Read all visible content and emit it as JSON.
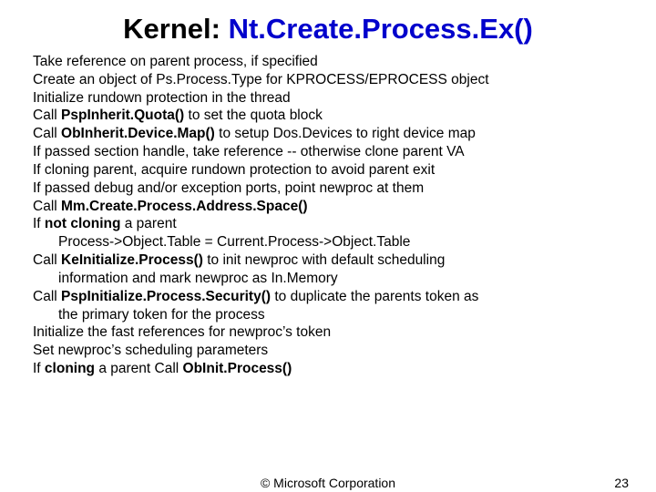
{
  "title": {
    "prefix": "Kernel:  ",
    "func": "Nt.Create.Process.Ex()"
  },
  "lines": {
    "l1": "Take reference on parent process, if specified",
    "l2": "Create an object of Ps.Process.Type for KPROCESS/EPROCESS object",
    "l3": "Initialize rundown protection in the thread",
    "l4a": "Call ",
    "l4b": "PspInherit.Quota()",
    "l4c": " to set the quota block",
    "l5a": "Call ",
    "l5b": "ObInherit.Device.Map()",
    "l5c": " to setup Dos.Devices to right device map",
    "l6": "If passed section handle, take reference -- otherwise clone parent VA",
    "l7": "If cloning parent, acquire rundown protection to avoid parent exit",
    "l8": "If passed debug and/or exception ports, point newproc at them",
    "l9a": "Call ",
    "l9b": "Mm.Create.Process.Address.Space()",
    "l10a": "If ",
    "l10b": "not cloning",
    "l10c": " a parent",
    "l11": "Process->Object.Table = Current.Process->Object.Table",
    "l12a": "Call ",
    "l12b": "KeInitialize.Process()",
    "l12c": " to init newproc with default scheduling",
    "l13": "information and mark newproc as In.Memory",
    "l14a": "Call ",
    "l14b": "PspInitialize.Process.Security()",
    "l14c": " to duplicate the parents token as",
    "l15": "the primary token for the process",
    "l16": "Initialize the fast references for newproc’s token",
    "l17": "Set newproc’s scheduling parameters",
    "l18a": "If ",
    "l18b": "cloning",
    "l18c": " a parent Call ",
    "l18d": "ObInit.Process()"
  },
  "footer": {
    "copyright": "© Microsoft Corporation",
    "page": "23"
  }
}
